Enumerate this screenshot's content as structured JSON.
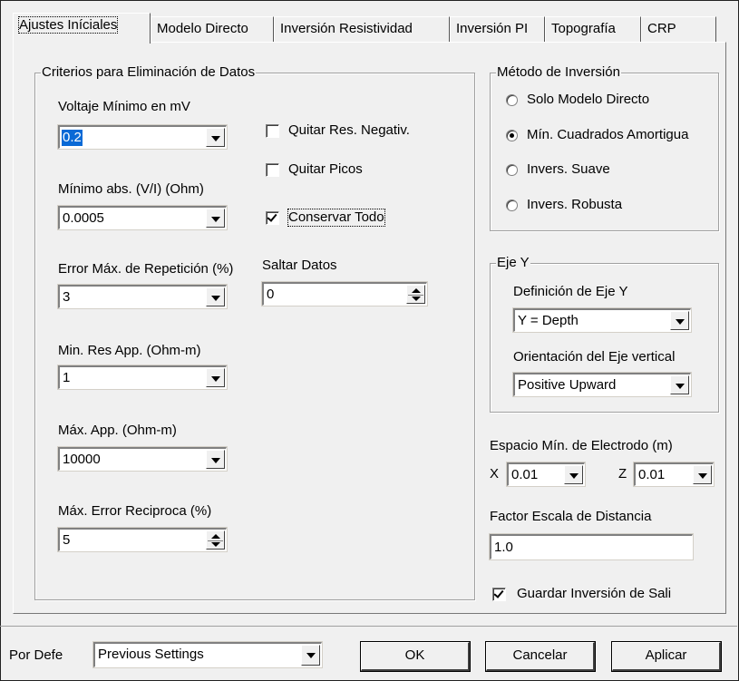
{
  "tabs": [
    {
      "label": "Ajustes Iníciales",
      "active": true
    },
    {
      "label": "Modelo Directo",
      "active": false
    },
    {
      "label": "Inversión Resistividad",
      "active": false
    },
    {
      "label": "Inversión PI",
      "active": false
    },
    {
      "label": "Topografía",
      "active": false
    },
    {
      "label": "CRP",
      "active": false
    }
  ],
  "criteria": {
    "title": "Criterios para Eliminación de Datos",
    "min_voltage_label": "Voltaje Mínimo en mV",
    "min_voltage_value": "0.2",
    "min_abs_label": "Mínimo abs. (V/I) (Ohm)",
    "min_abs_value": "0.0005",
    "max_repeat_error_label": "Error Máx. de Repetición (%)",
    "max_repeat_error_value": "3",
    "min_res_app_label": "Min. Res App. (Ohm-m)",
    "min_res_app_value": "1",
    "max_app_label": "Máx. App. (Ohm-m)",
    "max_app_value": "10000",
    "max_reciprocal_error_label": "Máx. Error Reciproca (%)",
    "max_reciprocal_error_value": "5",
    "remove_negative_label": "Quitar Res. Negativ.",
    "remove_negative_checked": false,
    "remove_peaks_label": "Quitar Picos",
    "remove_peaks_checked": false,
    "keep_all_label": "Conservar Todo",
    "keep_all_checked": true,
    "skip_data_label": "Saltar Datos",
    "skip_data_value": "0"
  },
  "inversion_method": {
    "title": "Método de  Inversión",
    "options": [
      {
        "label": "Solo Modelo Directo",
        "selected": false
      },
      {
        "label": "Mín. Cuadrados Amortigua",
        "selected": true
      },
      {
        "label": "Invers. Suave",
        "selected": false
      },
      {
        "label": "Invers. Robusta",
        "selected": false
      }
    ]
  },
  "y_axis": {
    "title": "Eje Y",
    "definition_label": "Definición de Eje Y",
    "definition_value": "Y = Depth",
    "orientation_label": "Orientación del Eje vertical",
    "orientation_value": "Positive Upward"
  },
  "electrode": {
    "label": "Espacio Mín. de Electrodo (m)",
    "x_label": "X",
    "x_value": "0.01",
    "z_label": "Z",
    "z_value": "0.01"
  },
  "distance_scale": {
    "label": "Factor Escala de Distancia",
    "value": "1.0"
  },
  "save_inversion": {
    "label": "Guardar Inversión de Sali",
    "checked": true
  },
  "footer": {
    "default_label": "Por Defe",
    "preset_value": "Previous Settings",
    "ok_label": "OK",
    "cancel_label": "Cancelar",
    "apply_label": "Aplicar"
  }
}
